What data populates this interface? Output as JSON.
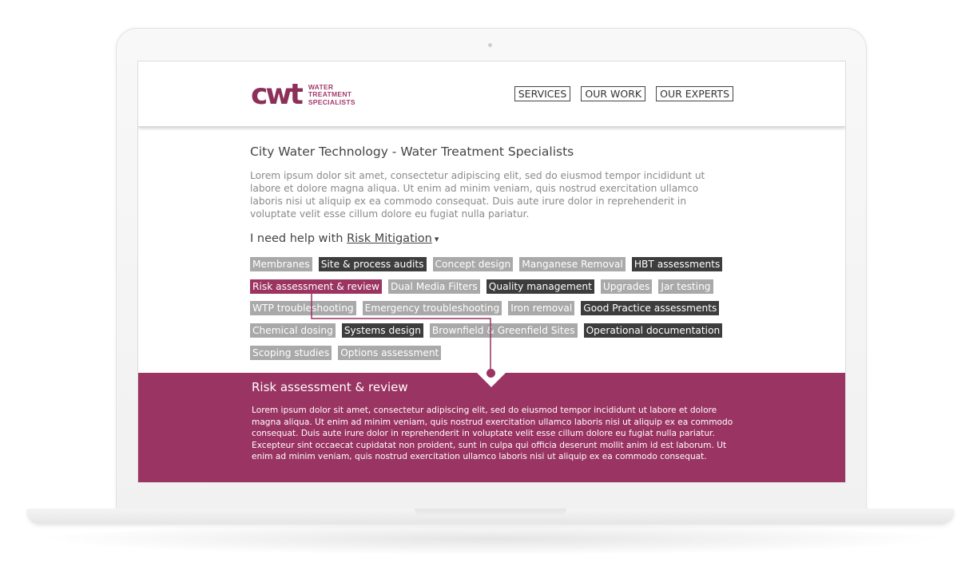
{
  "header": {
    "logo_mark": "cwt",
    "logo_lines": [
      "WATER",
      "TREATMENT",
      "SPECIALISTS"
    ],
    "nav": [
      "SERVICES",
      "OUR WORK",
      "OUR EXPERTS"
    ]
  },
  "main": {
    "title": "City Water Technology - Water Treatment Specialists",
    "intro": "Lorem ipsum dolor sit amet, consectetur adipiscing elit, sed do eiusmod tempor incididunt ut labore et dolore magna aliqua. Ut enim ad minim veniam, quis nostrud exercitation ullamco laboris nisi ut aliquip ex ea commodo consequat. Duis aute irure dolor in reprehenderit in voluptate velit esse cillum dolore eu fugiat nulla pariatur.",
    "help_prefix": "I need help with",
    "help_topic": "Risk Mitigation",
    "help_chevron": "▾"
  },
  "tags": [
    [
      {
        "label": "Membranes",
        "style": "light"
      },
      {
        "label": "Site & process audits",
        "style": "dark"
      },
      {
        "label": "Concept design",
        "style": "light"
      },
      {
        "label": "Manganese Removal",
        "style": "light"
      },
      {
        "label": "HBT assessments",
        "style": "dark"
      }
    ],
    [
      {
        "label": "Risk assessment & review",
        "style": "active"
      },
      {
        "label": "Dual Media Filters",
        "style": "light"
      },
      {
        "label": "Quality management",
        "style": "dark"
      },
      {
        "label": "Upgrades",
        "style": "light"
      },
      {
        "label": "Jar testing",
        "style": "light"
      }
    ],
    [
      {
        "label": "WTP troubleshooting",
        "style": "light"
      },
      {
        "label": "Emergency troubleshooting",
        "style": "light"
      },
      {
        "label": "Iron removal",
        "style": "light"
      },
      {
        "label": "Good Practice assessments",
        "style": "dark"
      }
    ],
    [
      {
        "label": "Chemical dosing",
        "style": "light"
      },
      {
        "label": "Systems design",
        "style": "dark"
      },
      {
        "label": "Brownfield & Greenfield Sites",
        "style": "light"
      },
      {
        "label": "Operational documentation",
        "style": "dark"
      }
    ],
    [
      {
        "label": "Scoping studies",
        "style": "light"
      },
      {
        "label": "Options assessment",
        "style": "light"
      }
    ]
  ],
  "panel": {
    "title": "Risk assessment & review",
    "body": "Lorem ipsum dolor sit amet, consectetur adipiscing elit, sed do eiusmod tempor incididunt ut labore et dolore magna aliqua. Ut enim ad minim veniam, quis nostrud exercitation ullamco laboris nisi ut aliquip ex ea commodo consequat. Duis aute irure dolor in reprehenderit in voluptate velit esse cillum dolore eu fugiat nulla pariatur. Excepteur sint occaecat cupidatat non proident, sunt in culpa qui officia deserunt mollit anim id est laborum. Ut enim ad minim veniam, quis nostrud exercitation ullamco laboris nisi ut aliquip ex ea commodo consequat."
  },
  "colors": {
    "brand": "#8c2f59",
    "tag_active": "#9c3462",
    "tag_dark": "#3d3d3d",
    "tag_light": "#a9a9a9",
    "panel_bg": "#9a3462"
  }
}
